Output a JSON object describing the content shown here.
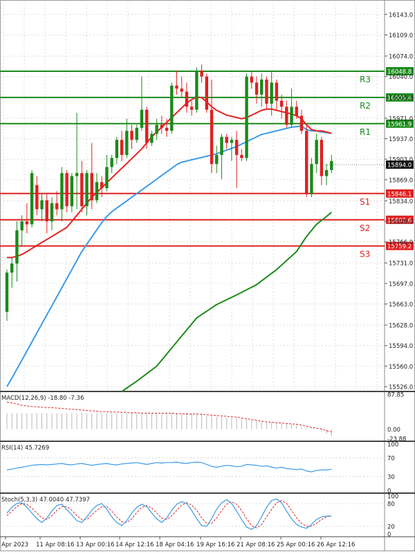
{
  "chart_data": {
    "type": "candlestick",
    "price_axis": {
      "ticks": [
        16143.0,
        16109.0,
        16074.0,
        16040.0,
        16005.0,
        15971.0,
        15937.0,
        15903.0,
        15869.0,
        15834.0,
        15800.0,
        15766.0,
        15731.0,
        15697.0,
        15663.0,
        15628.0,
        15594.0,
        15560.0,
        15526.0
      ],
      "tick_labels": [
        "16143.0",
        "16109.0",
        "16074.0",
        "16040.0",
        "16005.0",
        "15971.0",
        "15937.0",
        "15903.0",
        "15869.0",
        "15834.0",
        "15800.0",
        "15766.0",
        "15731.0",
        "15697.0",
        "15663.0",
        "15628.0",
        "15594.0",
        "15560.0",
        "15526.0"
      ],
      "range": [
        15518,
        16160
      ],
      "current_price": {
        "value": 15894.0,
        "label": "15894.0"
      }
    },
    "time_axis_labels": [
      "Apr 2023",
      "11 Apr 08:16",
      "13 Apr 00:16",
      "14 Apr 12:16",
      "18 Apr 04:16",
      "19 Apr 16:16",
      "21 Apr 08:16",
      "25 Apr 00:16",
      "26 Apr 12:16"
    ],
    "levels": [
      {
        "name": "R3",
        "value": 16048.8,
        "label": "16048.8",
        "color": "#1a8a1a"
      },
      {
        "name": "R2",
        "value": 16005.4,
        "label": "16005.4",
        "color": "#1a8a1a"
      },
      {
        "name": "R1",
        "value": 15961.9,
        "label": "15961.9",
        "color": "#1a8a1a"
      },
      {
        "name": "S1",
        "value": 15846.1,
        "label": "15846.1",
        "color": "#e02020"
      },
      {
        "name": "S2",
        "value": 15802.6,
        "label": "15802.6",
        "color": "#e02020"
      },
      {
        "name": "S3",
        "value": 15759.2,
        "label": "15759.2",
        "color": "#e02020"
      }
    ],
    "candles": [
      {
        "o": 15650,
        "h": 15720,
        "l": 15635,
        "c": 15715
      },
      {
        "o": 15715,
        "h": 15740,
        "l": 15690,
        "c": 15730
      },
      {
        "o": 15730,
        "h": 15800,
        "l": 15700,
        "c": 15785
      },
      {
        "o": 15785,
        "h": 15810,
        "l": 15760,
        "c": 15800
      },
      {
        "o": 15800,
        "h": 15830,
        "l": 15780,
        "c": 15795
      },
      {
        "o": 15795,
        "h": 15885,
        "l": 15790,
        "c": 15880
      },
      {
        "o": 15860,
        "h": 15875,
        "l": 15810,
        "c": 15820
      },
      {
        "o": 15820,
        "h": 15845,
        "l": 15800,
        "c": 15835
      },
      {
        "o": 15835,
        "h": 15845,
        "l": 15780,
        "c": 15800
      },
      {
        "o": 15800,
        "h": 15840,
        "l": 15785,
        "c": 15830
      },
      {
        "o": 15830,
        "h": 15850,
        "l": 15810,
        "c": 15820
      },
      {
        "o": 15820,
        "h": 15890,
        "l": 15800,
        "c": 15880
      },
      {
        "o": 15880,
        "h": 15885,
        "l": 15815,
        "c": 15825
      },
      {
        "o": 15825,
        "h": 15880,
        "l": 15815,
        "c": 15875
      },
      {
        "o": 15875,
        "h": 15980,
        "l": 15820,
        "c": 15880
      },
      {
        "o": 15880,
        "h": 15900,
        "l": 15815,
        "c": 15825
      },
      {
        "o": 15825,
        "h": 15885,
        "l": 15810,
        "c": 15880
      },
      {
        "o": 15880,
        "h": 15930,
        "l": 15820,
        "c": 15835
      },
      {
        "o": 15835,
        "h": 15880,
        "l": 15830,
        "c": 15865
      },
      {
        "o": 15865,
        "h": 15875,
        "l": 15840,
        "c": 15855
      },
      {
        "o": 15855,
        "h": 15910,
        "l": 15850,
        "c": 15890
      },
      {
        "o": 15890,
        "h": 15910,
        "l": 15880,
        "c": 15905
      },
      {
        "o": 15905,
        "h": 15940,
        "l": 15895,
        "c": 15935
      },
      {
        "o": 15935,
        "h": 15950,
        "l": 15900,
        "c": 15910
      },
      {
        "o": 15910,
        "h": 15970,
        "l": 15905,
        "c": 15950
      },
      {
        "o": 15950,
        "h": 15960,
        "l": 15920,
        "c": 15935
      },
      {
        "o": 15935,
        "h": 15960,
        "l": 15930,
        "c": 15955
      },
      {
        "o": 15955,
        "h": 16040,
        "l": 15950,
        "c": 15985
      },
      {
        "o": 15985,
        "h": 15990,
        "l": 15920,
        "c": 15930
      },
      {
        "o": 15930,
        "h": 15950,
        "l": 15925,
        "c": 15945
      },
      {
        "o": 15945,
        "h": 15970,
        "l": 15935,
        "c": 15960
      },
      {
        "o": 15960,
        "h": 15975,
        "l": 15945,
        "c": 15955
      },
      {
        "o": 15955,
        "h": 15970,
        "l": 15940,
        "c": 15950
      },
      {
        "o": 15950,
        "h": 16030,
        "l": 15945,
        "c": 16025
      },
      {
        "o": 16025,
        "h": 16050,
        "l": 16010,
        "c": 16020
      },
      {
        "o": 16020,
        "h": 16040,
        "l": 16005,
        "c": 16015
      },
      {
        "o": 16015,
        "h": 16030,
        "l": 15980,
        "c": 15990
      },
      {
        "o": 15990,
        "h": 16000,
        "l": 15975,
        "c": 15985
      },
      {
        "o": 15985,
        "h": 16055,
        "l": 15980,
        "c": 16050
      },
      {
        "o": 16050,
        "h": 16060,
        "l": 16030,
        "c": 16040
      },
      {
        "o": 16040,
        "h": 16045,
        "l": 15980,
        "c": 15985
      },
      {
        "o": 15985,
        "h": 16035,
        "l": 15880,
        "c": 15895
      },
      {
        "o": 15895,
        "h": 15925,
        "l": 15880,
        "c": 15910
      },
      {
        "o": 15910,
        "h": 15945,
        "l": 15870,
        "c": 15940
      },
      {
        "o": 15940,
        "h": 15945,
        "l": 15920,
        "c": 15930
      },
      {
        "o": 15930,
        "h": 15940,
        "l": 15900,
        "c": 15935
      },
      {
        "o": 15935,
        "h": 15950,
        "l": 15855,
        "c": 15910
      },
      {
        "o": 15910,
        "h": 15920,
        "l": 15900,
        "c": 15905
      },
      {
        "o": 15905,
        "h": 16045,
        "l": 15900,
        "c": 16040
      },
      {
        "o": 16040,
        "h": 16050,
        "l": 16020,
        "c": 16030
      },
      {
        "o": 16030,
        "h": 16040,
        "l": 15995,
        "c": 16010
      },
      {
        "o": 16010,
        "h": 16045,
        "l": 15990,
        "c": 16035
      },
      {
        "o": 16035,
        "h": 16040,
        "l": 15985,
        "c": 15995
      },
      {
        "o": 15995,
        "h": 16050,
        "l": 15975,
        "c": 16030
      },
      {
        "o": 16030,
        "h": 16035,
        "l": 15985,
        "c": 16000
      },
      {
        "o": 16000,
        "h": 16010,
        "l": 15970,
        "c": 15990
      },
      {
        "o": 15990,
        "h": 16000,
        "l": 15955,
        "c": 15960
      },
      {
        "o": 15960,
        "h": 16020,
        "l": 15955,
        "c": 15990
      },
      {
        "o": 15990,
        "h": 16000,
        "l": 15970,
        "c": 15975
      },
      {
        "o": 15975,
        "h": 15985,
        "l": 15945,
        "c": 15950
      },
      {
        "o": 15950,
        "h": 15960,
        "l": 15840,
        "c": 15845
      },
      {
        "o": 15845,
        "h": 15905,
        "l": 15840,
        "c": 15895
      },
      {
        "o": 15895,
        "h": 15945,
        "l": 15880,
        "c": 15935
      },
      {
        "o": 15935,
        "h": 15940,
        "l": 15860,
        "c": 15875
      },
      {
        "o": 15875,
        "h": 15895,
        "l": 15860,
        "c": 15885
      },
      {
        "o": 15885,
        "h": 15910,
        "l": 15880,
        "c": 15900
      }
    ],
    "ma_red": [
      15740,
      15740,
      15742,
      15745,
      15750,
      15755,
      15760,
      15765,
      15770,
      15775,
      15780,
      15785,
      15790,
      15800,
      15810,
      15820,
      15830,
      15840,
      15848,
      15856,
      15864,
      15872,
      15880,
      15888,
      15896,
      15904,
      15912,
      15920,
      15930,
      15940,
      15948,
      15956,
      15964,
      15972,
      15980,
      15988,
      15996,
      16002,
      16006,
      16005,
      15998,
      15990,
      15984,
      15980,
      15976,
      15974,
      15972,
      15970,
      15972,
      15976,
      15980,
      15984,
      15986,
      15986,
      15984,
      15982,
      15980,
      15978,
      15975,
      15970,
      15960,
      15952,
      15950,
      15950,
      15948,
      15946
    ],
    "ma_blue": [
      15526,
      15540,
      15555,
      15570,
      15585,
      15600,
      15615,
      15630,
      15645,
      15660,
      15675,
      15690,
      15705,
      15720,
      15735,
      15750,
      15762,
      15774,
      15786,
      15798,
      15808,
      15816,
      15822,
      15828,
      15834,
      15840,
      15846,
      15852,
      15858,
      15864,
      15870,
      15876,
      15882,
      15888,
      15894,
      15898,
      15900,
      15902,
      15904,
      15906,
      15908,
      15910,
      15912,
      15915,
      15918,
      15921,
      15924,
      15928,
      15932,
      15936,
      15940,
      15944,
      15946,
      15948,
      15950,
      15952,
      15954,
      15956,
      15957,
      15958,
      15952,
      15950,
      15950,
      15948,
      15947,
      15946
    ],
    "ma_green": [
      {
        "i": 23,
        "v": 15518
      },
      {
        "i": 26,
        "v": 15535
      },
      {
        "i": 30,
        "v": 15560
      },
      {
        "i": 34,
        "v": 15600
      },
      {
        "i": 38,
        "v": 15640
      },
      {
        "i": 42,
        "v": 15662
      },
      {
        "i": 46,
        "v": 15678
      },
      {
        "i": 50,
        "v": 15695
      },
      {
        "i": 54,
        "v": 15720
      },
      {
        "i": 58,
        "v": 15750
      },
      {
        "i": 60,
        "v": 15775
      },
      {
        "i": 62,
        "v": 15795
      },
      {
        "i": 64,
        "v": 15808
      },
      {
        "i": 65,
        "v": 15815
      }
    ],
    "macd": {
      "label": "MACD(12,26,9) -18.80 -7.36",
      "axis_labels": [
        "87.85",
        "0.00",
        "-23.88"
      ],
      "range": [
        -23.88,
        87.85
      ],
      "signal": [
        68,
        66,
        63,
        60,
        58,
        57,
        56,
        55,
        54,
        54,
        53,
        52,
        51,
        50,
        49,
        48,
        47,
        46,
        45,
        44,
        44,
        43,
        43,
        42,
        42,
        41,
        41,
        40,
        40,
        40,
        40,
        40,
        40,
        40,
        39,
        39,
        38,
        38,
        38,
        37,
        36,
        35,
        34,
        33,
        32,
        31,
        30,
        28,
        26,
        24,
        22,
        20,
        18,
        17,
        16,
        15,
        14,
        13,
        12,
        10,
        7,
        4,
        2,
        0,
        -4,
        -7.36
      ],
      "hist": [
        40,
        40,
        40,
        40,
        40,
        40,
        40,
        40,
        40,
        40,
        40,
        40,
        40,
        40,
        40,
        40,
        40,
        40,
        40,
        40,
        40,
        40,
        40,
        40,
        40,
        40,
        40,
        40,
        40,
        40,
        40,
        40,
        40,
        40,
        40,
        40,
        40,
        40,
        40,
        40,
        33,
        32,
        31,
        30,
        29,
        28,
        27,
        26,
        25,
        22,
        20,
        18,
        17,
        16,
        15,
        14,
        13,
        12,
        10,
        7,
        5,
        3,
        0,
        -6,
        -12,
        -18.8
      ]
    },
    "rsi": {
      "label": "RSI(14) 45.7269",
      "axis_labels": [
        "100",
        "70",
        "30",
        "0"
      ],
      "range": [
        0,
        100
      ],
      "values": [
        44,
        46,
        48,
        50,
        52,
        54,
        55,
        56,
        55,
        56,
        57,
        58,
        56,
        55,
        57,
        58,
        56,
        54,
        56,
        57,
        58,
        56,
        55,
        57,
        58,
        59,
        60,
        58,
        56,
        58,
        60,
        59,
        60,
        60,
        61,
        59,
        58,
        60,
        61,
        60,
        56,
        52,
        50,
        52,
        54,
        53,
        51,
        52,
        56,
        55,
        54,
        52,
        53,
        50,
        48,
        50,
        47,
        46,
        45,
        46,
        42,
        40,
        43,
        44,
        44,
        45.7269
      ]
    },
    "stoch": {
      "label": "Stoch(5,3,3) 47.0040 47.7397",
      "axis_labels": [
        "100",
        "80",
        "20",
        "0"
      ],
      "range": [
        0,
        100
      ],
      "k": [
        55,
        70,
        80,
        82,
        70,
        55,
        40,
        30,
        42,
        60,
        75,
        78,
        64,
        50,
        35,
        30,
        45,
        62,
        75,
        80,
        65,
        45,
        30,
        22,
        35,
        55,
        70,
        78,
        72,
        55,
        40,
        30,
        42,
        62,
        78,
        85,
        80,
        62,
        40,
        22,
        20,
        40,
        65,
        82,
        90,
        80,
        60,
        38,
        18,
        12,
        22,
        45,
        70,
        88,
        92,
        82,
        60,
        40,
        25,
        18,
        15,
        25,
        38,
        45,
        47,
        47.004
      ],
      "d": [
        48,
        60,
        72,
        80,
        78,
        68,
        55,
        42,
        38,
        48,
        62,
        72,
        72,
        62,
        48,
        38,
        38,
        50,
        62,
        72,
        72,
        60,
        45,
        32,
        30,
        40,
        56,
        70,
        75,
        68,
        55,
        42,
        38,
        48,
        62,
        76,
        82,
        76,
        62,
        42,
        28,
        28,
        42,
        62,
        78,
        85,
        78,
        62,
        40,
        22,
        16,
        25,
        45,
        65,
        82,
        88,
        80,
        62,
        42,
        28,
        20,
        20,
        28,
        38,
        45,
        47.7397
      ]
    }
  }
}
